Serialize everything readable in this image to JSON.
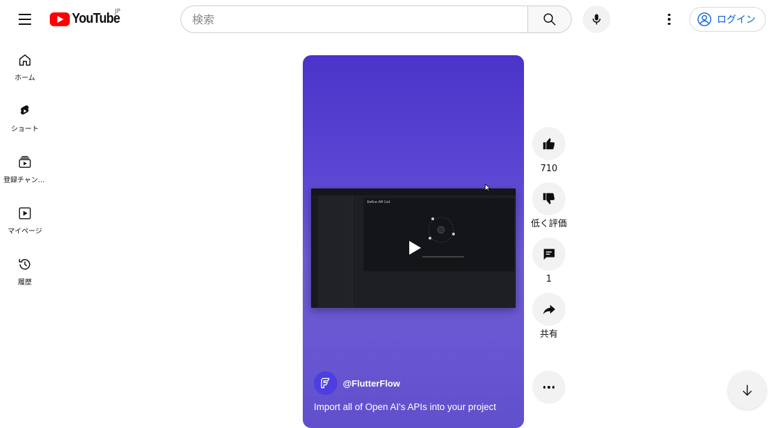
{
  "header": {
    "logo_text": "YouTube",
    "logo_region": "JP",
    "search_placeholder": "検索",
    "login_label": "ログイン"
  },
  "sidebar": {
    "items": [
      {
        "label": "ホーム",
        "icon": "home-icon"
      },
      {
        "label": "ショート",
        "icon": "shorts-icon"
      },
      {
        "label": "登録チャンネル",
        "icon": "subscriptions-icon"
      },
      {
        "label": "マイページ",
        "icon": "library-icon"
      },
      {
        "label": "履歴",
        "icon": "history-icon"
      }
    ]
  },
  "video": {
    "channel": "@FlutterFlow",
    "title": "Import all of Open AI's APIs into your project",
    "screen_heading": "Define API Call"
  },
  "actions": {
    "like_count": "710",
    "dislike_label": "低く評価",
    "comment_count": "1",
    "share_label": "共有"
  },
  "colors": {
    "brand_red": "#ff0000",
    "link_blue": "#065fd4",
    "player_purple": "#5a45d3"
  }
}
